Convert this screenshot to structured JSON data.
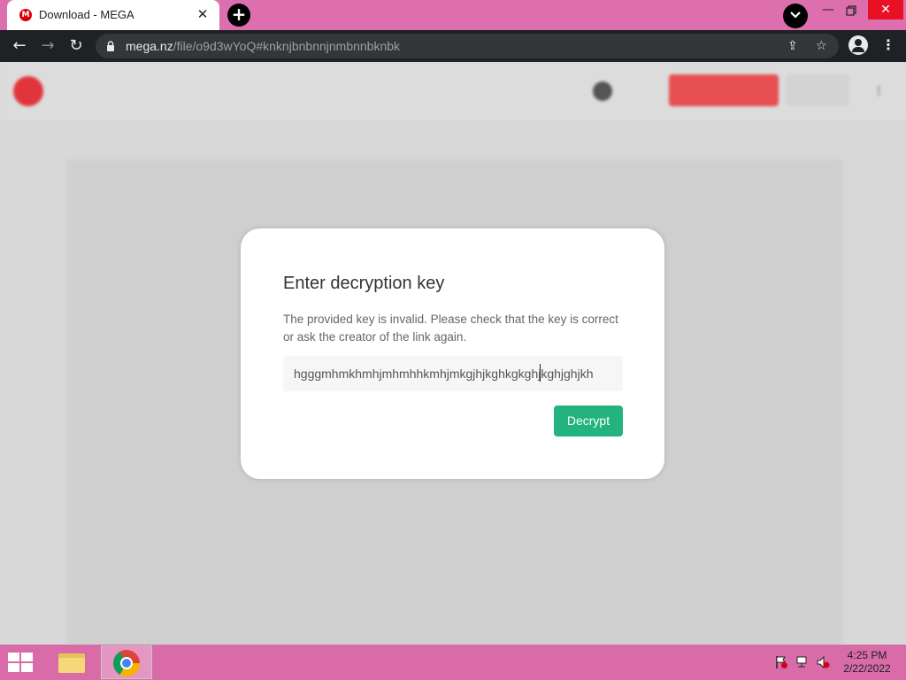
{
  "browser": {
    "tab_title": "Download - MEGA",
    "tab_favicon_letter": "M",
    "url_host": "mega.nz",
    "url_path": "/file/o9d3wYoQ#knknjbnbnnjnmbnnbknbk"
  },
  "dialog": {
    "title": "Enter decryption key",
    "message": "The provided key is invalid. Please check that the key is correct or ask the creator of the link again.",
    "key_value": "hgggmhmkhmhjmhmhhkmhjmkgjhjkghkgkghjkghjghjkh",
    "decrypt_label": "Decrypt"
  },
  "taskbar": {
    "time": "4:25 PM",
    "date": "2/22/2022"
  },
  "colors": {
    "tab_strip": "#dd6fae",
    "toolbar": "#202124",
    "decrypt_button": "#22b37f",
    "mega_red": "#e2353b",
    "taskbar": "#d96ca8"
  }
}
